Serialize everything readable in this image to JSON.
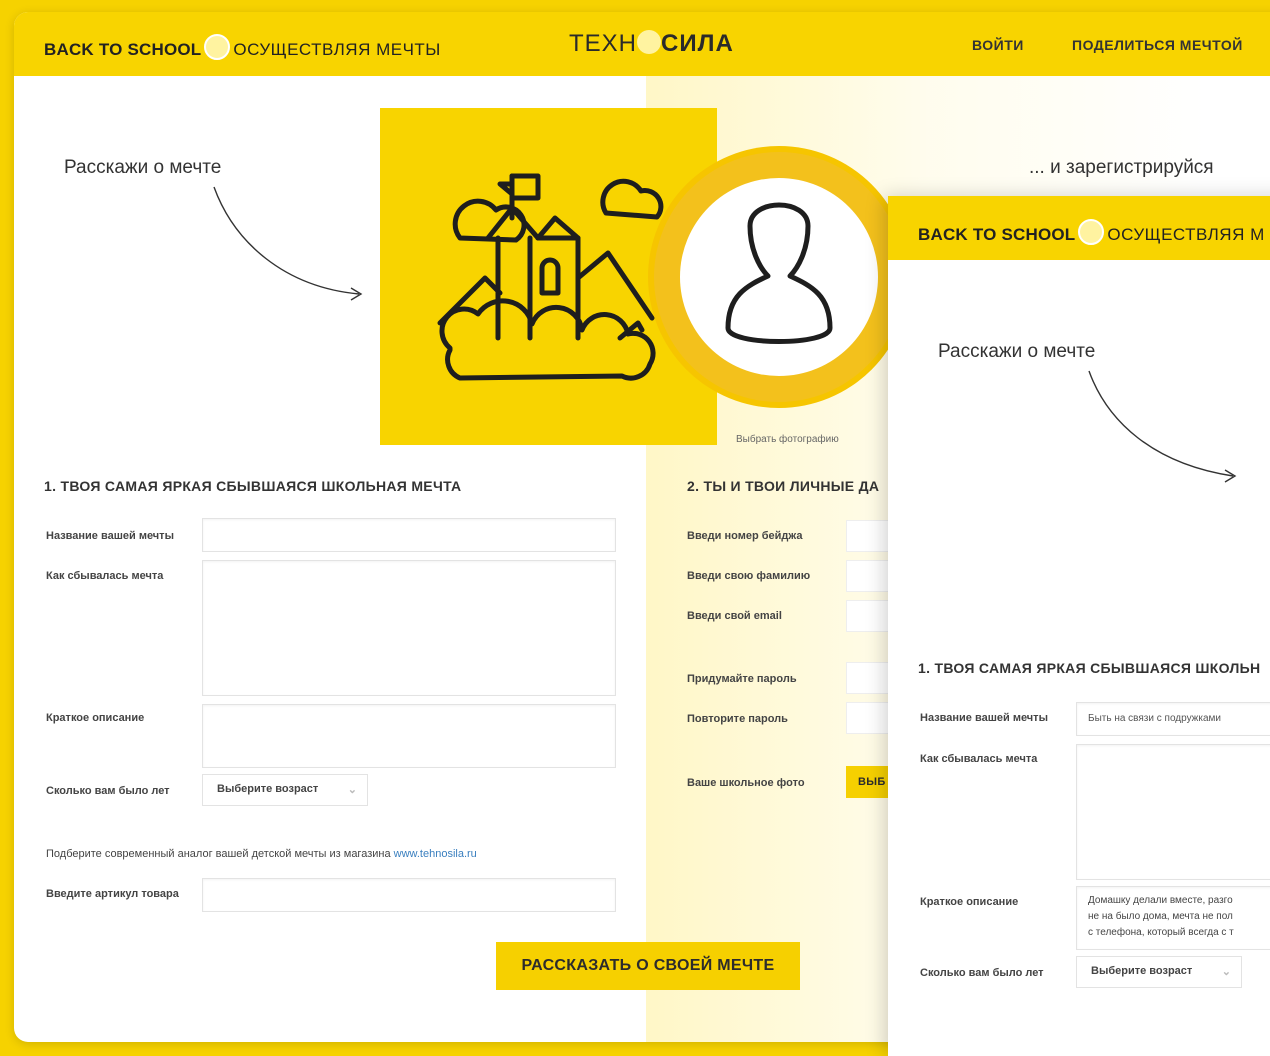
{
  "header": {
    "brand_bold": "BACK TO SCHOOL",
    "brand_sub": "ОСУЩЕСТВЛЯЯ МЕЧТЫ",
    "logo_left": "ТЕХН",
    "logo_right": "СИЛА",
    "nav_login": "ВОЙТИ",
    "nav_share": "ПОДЕЛИТЬСЯ МЕЧТОЙ"
  },
  "captions": {
    "left": "Расскажи о мечте",
    "right": "... и зарегистрируйся"
  },
  "avatar": {
    "photo_note": "Выбрать фотографию"
  },
  "form1": {
    "section_title": "1. ТВОЯ САМАЯ ЯРКАЯ СБЫВШАЯСЯ ШКОЛЬНАЯ МЕЧТА",
    "dream_name_label": "Название вашей мечты",
    "how_label": "Как сбывалась мечта",
    "short_desc_label": "Краткое описание",
    "age_label": "Сколько вам было лет",
    "age_select": "Выберите возраст",
    "hint_text": "Подберите современный аналог вашей детской мечты из магазина",
    "hint_link": "www.tehnosila.ru",
    "sku_label": "Введите артикул товара",
    "submit": "РАССКАЗАТЬ О СВОЕЙ МЕЧТЕ"
  },
  "form2": {
    "section_title": "2. ТЫ И ТВОИ ЛИЧНЫЕ ДА",
    "badge_label": "Введи номер бейджа",
    "surname_label": "Введи свою фамилию",
    "email_label": "Введи свой email",
    "password_label": "Придумайте пароль",
    "password_repeat_label": "Повторите пароль",
    "photo_label": "Ваше школьное фото",
    "photo_button": "ВЫБ"
  },
  "screen2": {
    "brand_bold": "BACK TO SCHOOL",
    "brand_sub": "ОСУЩЕСТВЛЯЯ М",
    "caption": "Расскажи о мечте",
    "section_title": "1. ТВОЯ САМАЯ ЯРКАЯ СБЫВШАЯСЯ ШКОЛЬН",
    "dream_name_label": "Название вашей мечты",
    "dream_name_value": "Быть на связи с подружками",
    "how_label": "Как сбывалась мечта",
    "short_desc_label": "Краткое описание",
    "short_desc_lines": [
      "Домашку делали вместе, разго",
      "не на было дома, мечта не пол",
      "с телефона, который всегда с т"
    ],
    "age_label": "Сколько вам было лет",
    "age_select": "Выберите возраст"
  }
}
